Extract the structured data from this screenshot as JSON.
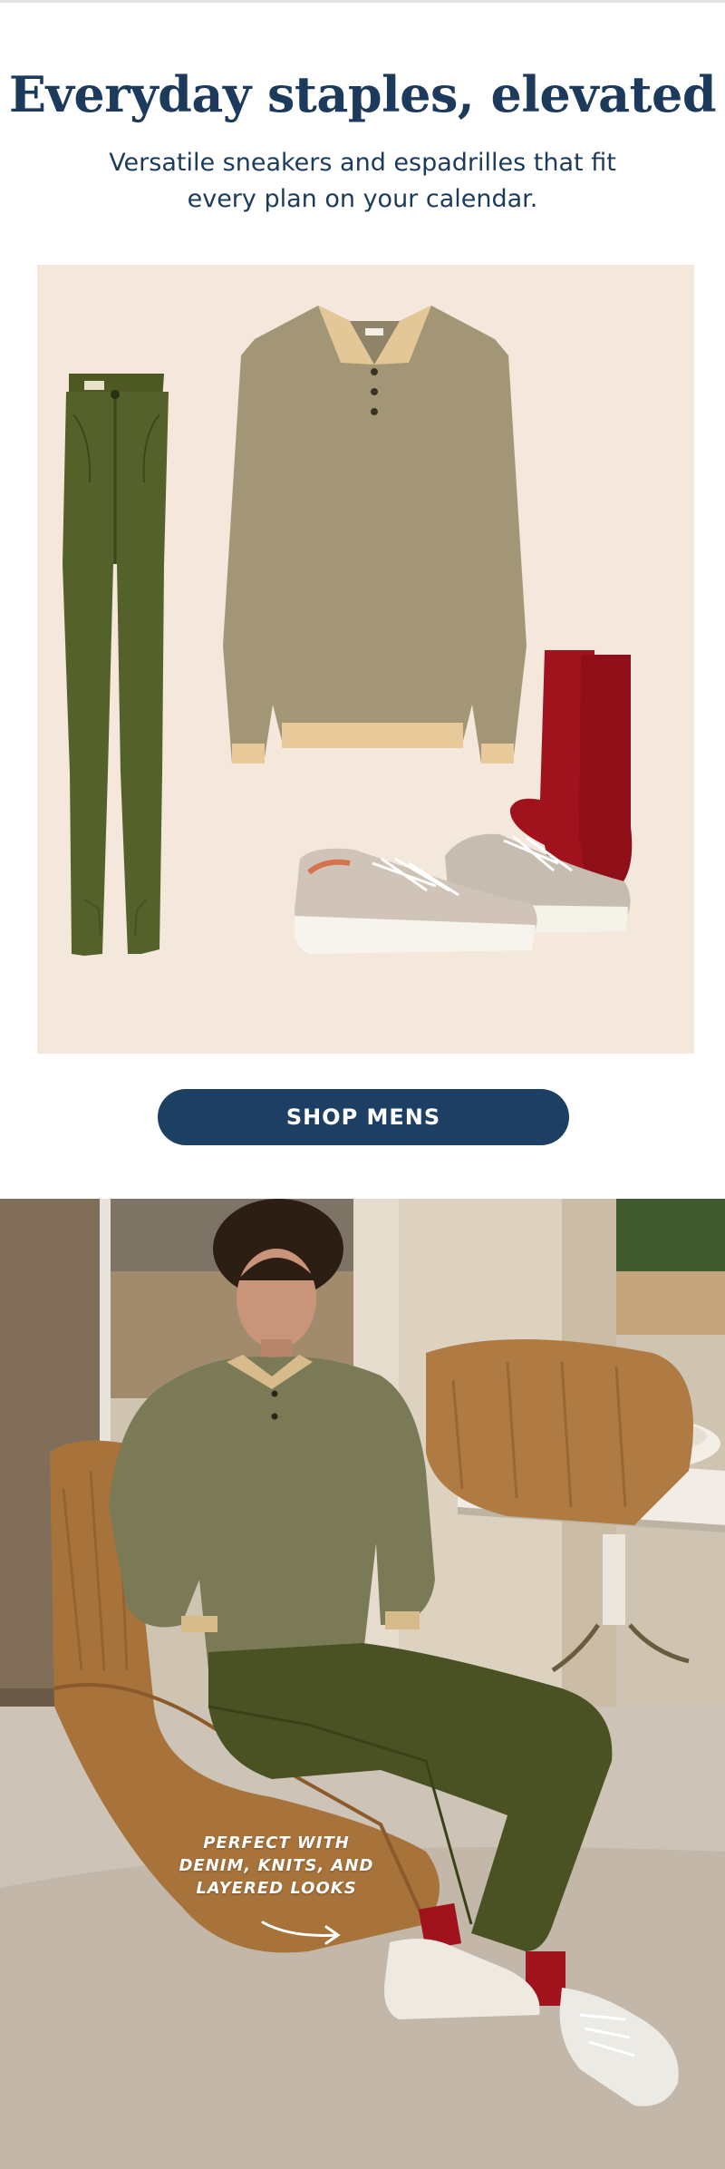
{
  "hero": {
    "headline": "Everyday staples, elevated",
    "subheadline": "Versatile sneakers and espadrilles that fit every plan on your calendar."
  },
  "flatlay": {
    "items": [
      "olive-chino-pants",
      "taupe-polo-sweatshirt",
      "red-crew-socks",
      "suede-low-top-sneakers"
    ]
  },
  "cta": {
    "label": "SHOP MENS"
  },
  "lifestyle": {
    "annotation": "PERFECT WITH\nDENIM, KNITS, AND\nLAYERED LOOKS",
    "icons": [
      "curved-arrow-icon"
    ]
  },
  "colors": {
    "brand_navy": "#1c3a5c",
    "button_navy": "#1c3f63",
    "panel_cream": "#f4e7dc",
    "olive": "#4f5a22",
    "taupe": "#a89a80",
    "sock_red": "#a0121c"
  }
}
